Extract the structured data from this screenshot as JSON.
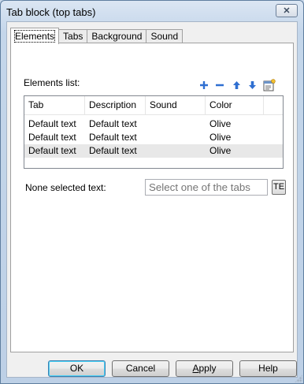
{
  "window": {
    "title": "Tab block (top tabs)",
    "close_glyph": "✕"
  },
  "tabs": [
    {
      "label": "Elements",
      "active": true
    },
    {
      "label": "Tabs",
      "active": false
    },
    {
      "label": "Background",
      "active": false
    },
    {
      "label": "Sound",
      "active": false
    }
  ],
  "elements_panel": {
    "list_label": "Elements list:",
    "toolbar_icons": [
      "add-icon",
      "remove-icon",
      "move-up-icon",
      "move-down-icon",
      "properties-icon"
    ],
    "columns": [
      "Tab",
      "Description",
      "Sound",
      "Color"
    ],
    "rows": [
      [
        "Default text",
        "Default text",
        "",
        "Olive"
      ],
      [
        "Default text",
        "Default text",
        "",
        "Olive"
      ],
      [
        "Default text",
        "Default text",
        "",
        "Olive"
      ]
    ],
    "none_selected_label": "None selected text:",
    "none_selected_placeholder": "Select one of the tabs",
    "te_button": "TE"
  },
  "buttons": {
    "ok": "OK",
    "cancel": "Cancel",
    "apply": "Apply",
    "help": "Help"
  },
  "colors": {
    "accent_blue": "#2f6fd1",
    "default_button_border": "#3c7fb1"
  }
}
